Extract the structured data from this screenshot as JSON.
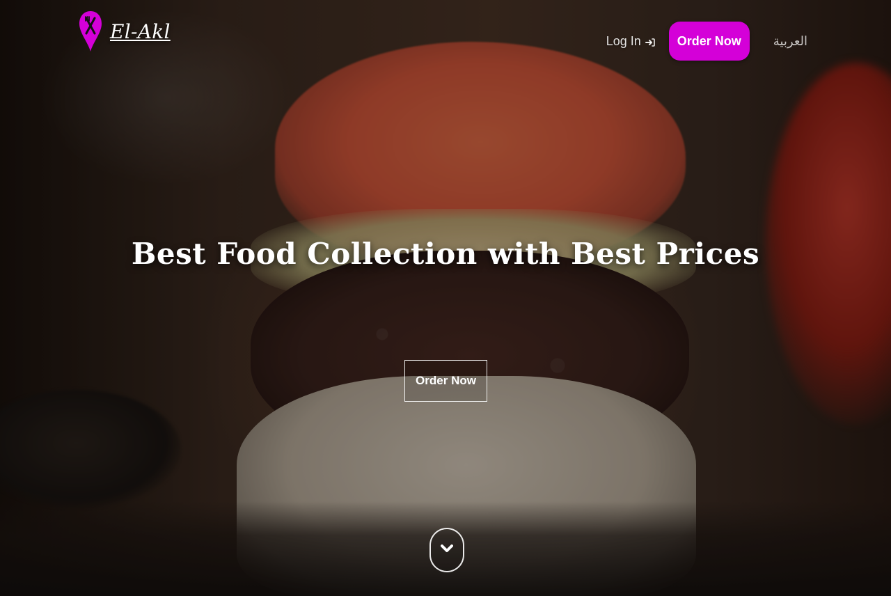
{
  "brand": {
    "name": "El-Akl",
    "accent_color": "#d400d8",
    "logo_icon": "map-pin-fork-knife-icon"
  },
  "nav": {
    "login_label": "Log In",
    "login_icon": "sign-in-arrow-icon",
    "order_label": "Order Now",
    "language_label": "العربية"
  },
  "hero": {
    "headline": "Best Food Collection with Best Prices",
    "cta_label": "Order Now",
    "scroll_icon": "chevron-down-icon"
  }
}
